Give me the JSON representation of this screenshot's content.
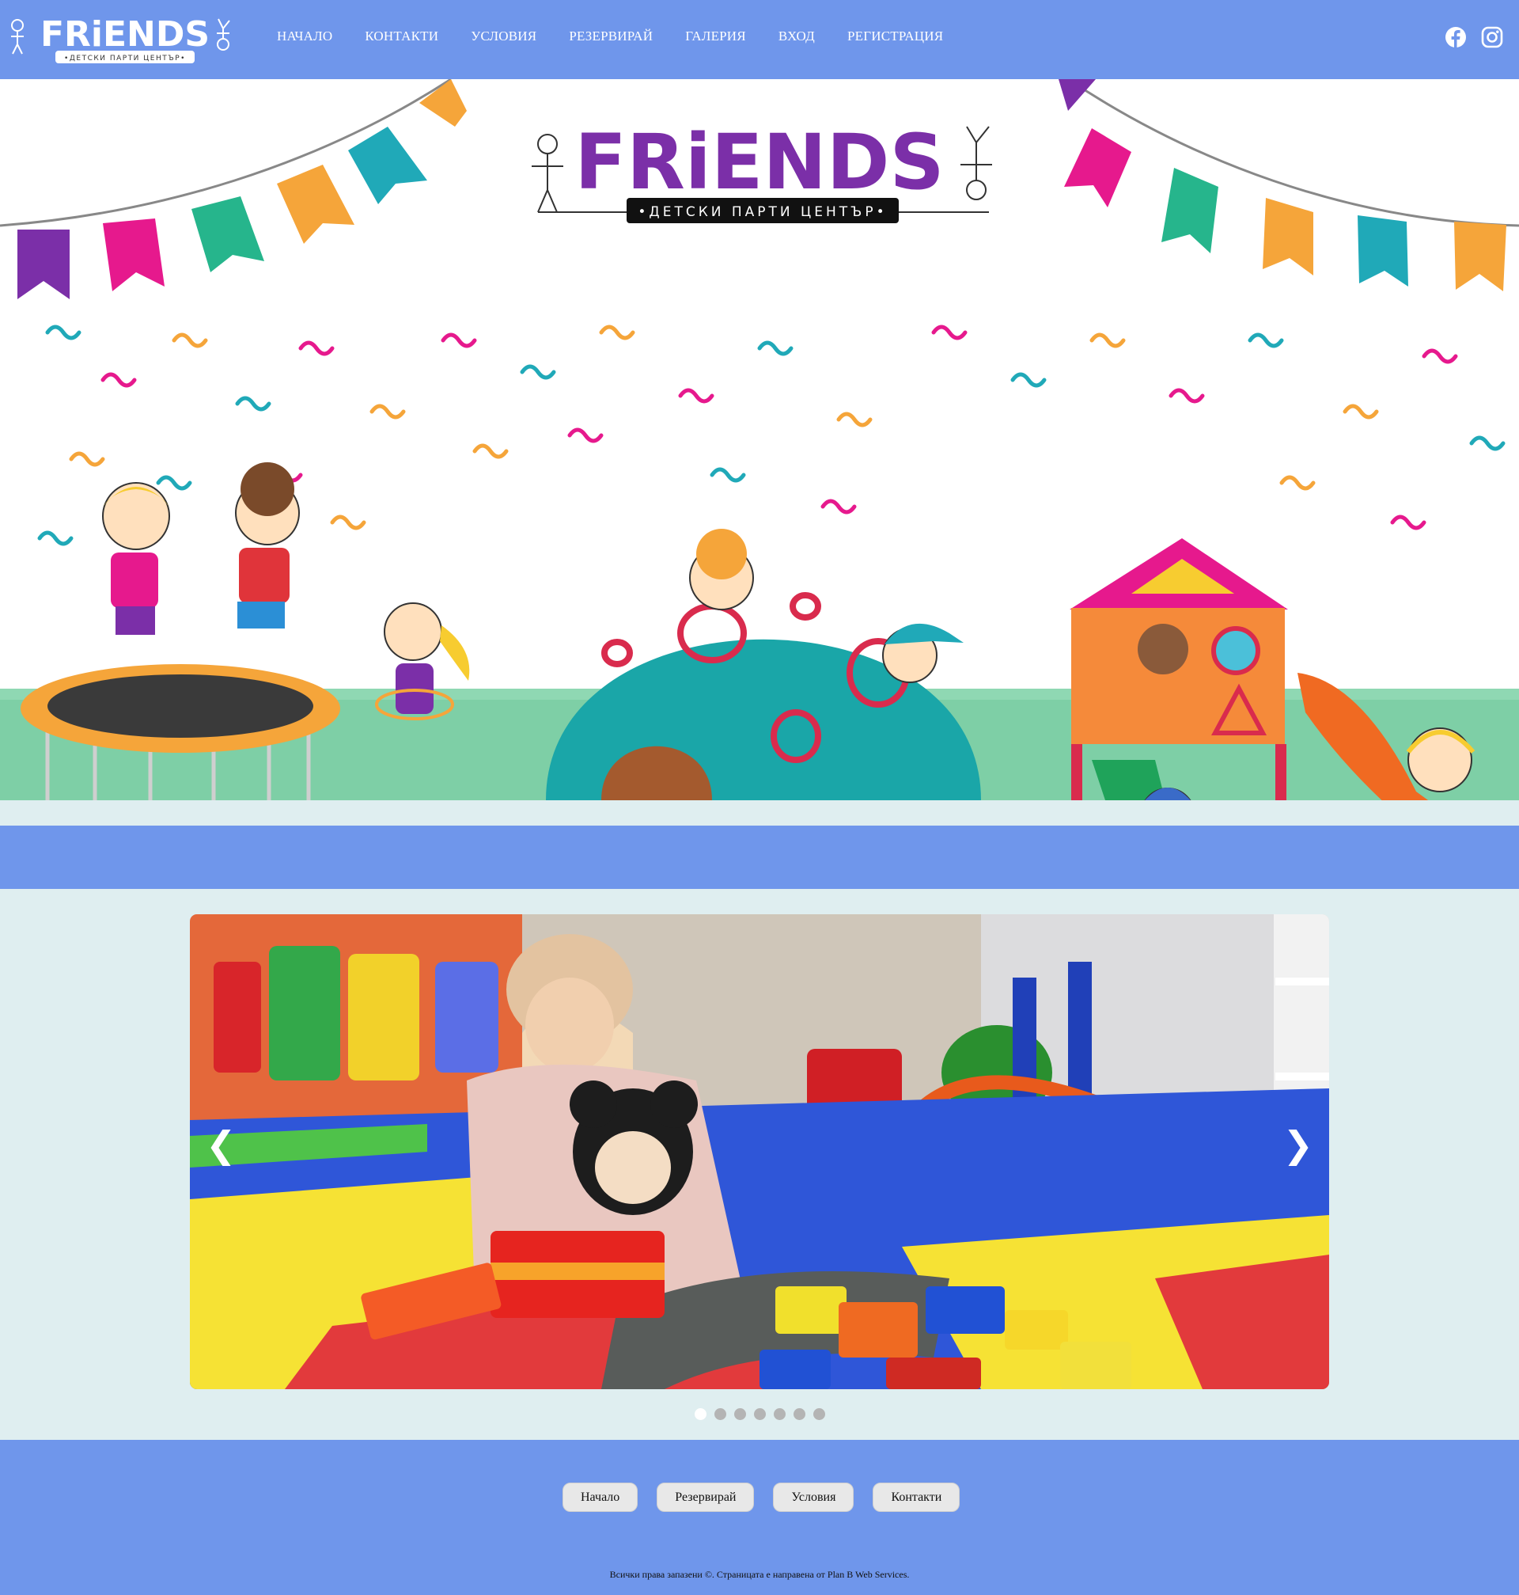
{
  "header": {
    "logo_text": "FRiENDS",
    "logo_subtext": "•ДЕТСКИ ПАРТИ ЦЕНТЪР•",
    "nav": [
      {
        "label": "НАЧАЛО"
      },
      {
        "label": "КОНТАКТИ"
      },
      {
        "label": "УСЛОВИЯ"
      },
      {
        "label": "РЕЗЕРВИРАЙ"
      },
      {
        "label": "ГАЛЕРИЯ"
      },
      {
        "label": "ВХОД"
      },
      {
        "label": "РЕГИСТРАЦИЯ"
      }
    ],
    "social": [
      "facebook-icon",
      "instagram-icon"
    ]
  },
  "hero": {
    "logo_text": "FRiENDS",
    "logo_subtext": "•ДЕТСКИ ПАРТИ ЦЕНТЪР•"
  },
  "carousel": {
    "prev": "❮",
    "next": "❯",
    "slide_count": 7,
    "active_index": 0
  },
  "footer": {
    "buttons": [
      {
        "label": "Начало"
      },
      {
        "label": "Резервирай"
      },
      {
        "label": "Условия"
      },
      {
        "label": "Контакти"
      }
    ],
    "copyright": "Всички права запазени ©. Страницата е направена от Plan B Web Services."
  },
  "colors": {
    "header_bg": "#6f96eb",
    "page_bg": "#dfeef0",
    "button_bg": "#e8e8e8"
  }
}
